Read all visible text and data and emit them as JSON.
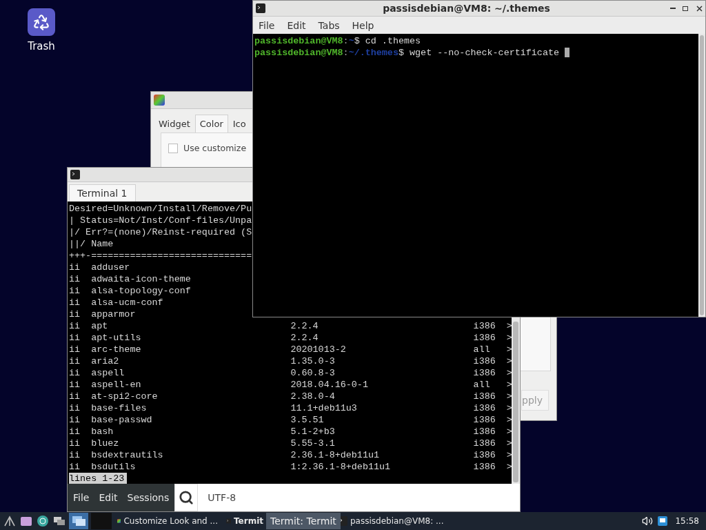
{
  "desktop_icons": [
    {
      "label": "Trash"
    }
  ],
  "customize_window": {
    "tabs": [
      {
        "label": "Widget",
        "selected": false
      },
      {
        "label": "Color",
        "selected": true
      },
      {
        "label": "Ico",
        "selected": false
      }
    ],
    "checkbox": {
      "label": "Use customize",
      "checked": false
    },
    "button": "pply"
  },
  "termit_window": {
    "tabs": [
      {
        "label": "Terminal 1",
        "selected": true
      }
    ],
    "header_lines": [
      "Desired=Unknown/Install/Remove/Pu",
      "| Status=Not/Inst/Conf-files/Unpa",
      "|/ Err?=(none)/Reinst-required (S",
      "||/ Name",
      "+++-============================="
    ],
    "packages": [
      {
        "status": "ii",
        "name": "adduser"
      },
      {
        "status": "ii",
        "name": "adwaita-icon-theme"
      },
      {
        "status": "ii",
        "name": "alsa-topology-conf"
      },
      {
        "status": "ii",
        "name": "alsa-ucm-conf"
      },
      {
        "status": "ii",
        "name": "apparmor"
      },
      {
        "status": "ii",
        "name": "apt",
        "version": "2.2.4",
        "arch": "i386",
        "mark": ">"
      },
      {
        "status": "ii",
        "name": "apt-utils",
        "version": "2.2.4",
        "arch": "i386",
        "mark": ">"
      },
      {
        "status": "ii",
        "name": "arc-theme",
        "version": "20201013-2",
        "arch": "all",
        "mark": ">"
      },
      {
        "status": "ii",
        "name": "aria2",
        "version": "1.35.0-3",
        "arch": "i386",
        "mark": ">"
      },
      {
        "status": "ii",
        "name": "aspell",
        "version": "0.60.8-3",
        "arch": "i386",
        "mark": ">"
      },
      {
        "status": "ii",
        "name": "aspell-en",
        "version": "2018.04.16-0-1",
        "arch": "all",
        "mark": ">"
      },
      {
        "status": "ii",
        "name": "at-spi2-core",
        "version": "2.38.0-4",
        "arch": "i386",
        "mark": ">"
      },
      {
        "status": "ii",
        "name": "base-files",
        "version": "11.1+deb11u3",
        "arch": "i386",
        "mark": ">"
      },
      {
        "status": "ii",
        "name": "base-passwd",
        "version": "3.5.51",
        "arch": "i386",
        "mark": ">"
      },
      {
        "status": "ii",
        "name": "bash",
        "version": "5.1-2+b3",
        "arch": "i386",
        "mark": ">"
      },
      {
        "status": "ii",
        "name": "bluez",
        "version": "5.55-3.1",
        "arch": "i386",
        "mark": ">"
      },
      {
        "status": "ii",
        "name": "bsdextrautils",
        "version": "2.36.1-8+deb11u1",
        "arch": "i386",
        "mark": ">"
      },
      {
        "status": "ii",
        "name": "bsdutils",
        "version": "1:2.36.1-8+deb11u1",
        "arch": "i386",
        "mark": ">"
      }
    ],
    "pager_status": "lines 1-23",
    "menu": [
      "File",
      "Edit",
      "Sessions"
    ],
    "encoding": "UTF-8"
  },
  "main_terminal": {
    "title": "passisdebian@VM8: ~/.themes",
    "menu": [
      "File",
      "Edit",
      "Tabs",
      "Help"
    ],
    "cursor_visible": true,
    "lines": [
      {
        "user": "passisdebian@VM8",
        "separator": ":",
        "path": "~",
        "prompt": "$",
        "command": "cd .themes"
      },
      {
        "user": "passisdebian@VM8",
        "separator": ":",
        "path": "~/.themes",
        "prompt": "$",
        "command": "wget --no-check-certificate"
      }
    ]
  },
  "taskbar": {
    "tasks": [
      {
        "label": "Customize Look and ...",
        "selected": false
      },
      {
        "label": "Termit",
        "selected": true
      },
      {
        "label": "passisdebian@VM8: ...",
        "selected": false
      }
    ],
    "tooltip": "Termit: Termit",
    "clock": "15:58"
  }
}
